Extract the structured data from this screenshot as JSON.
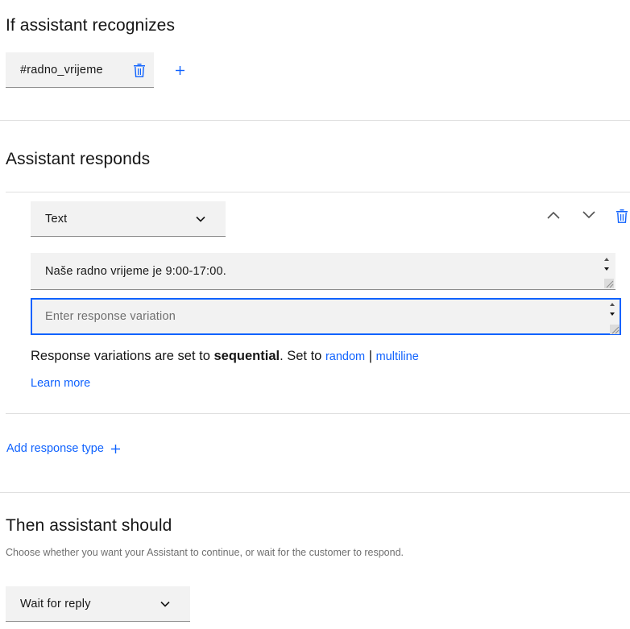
{
  "recognizes": {
    "title": "If assistant recognizes",
    "condition_value": "#radno_vrijeme"
  },
  "responds": {
    "title": "Assistant responds",
    "response_type": "Text",
    "variation_1": "Naše radno vrijeme je 9:00-17:00.",
    "variation_placeholder": "Enter response variation",
    "info_prefix": "Response variations are set to ",
    "info_mode": "sequential",
    "info_mid": ". Set to ",
    "info_random": "random",
    "info_sep": " | ",
    "info_multiline": "multiline",
    "learn_more": "Learn more",
    "add_response_type": "Add response type"
  },
  "then": {
    "title": "Then assistant should",
    "description": "Choose whether you want your Assistant to continue, or wait for the customer to respond.",
    "action_value": "Wait for reply"
  },
  "colors": {
    "link": "#0f62fe",
    "field_bg": "#f2f2f2",
    "focus_border": "#0f62fe",
    "text": "#161616",
    "divider": "#e0e0e0"
  },
  "icons": {
    "delete": "trash-icon",
    "add": "plus-icon",
    "chevron_down": "chevron-down-icon",
    "chevron_up": "chevron-up-icon"
  }
}
